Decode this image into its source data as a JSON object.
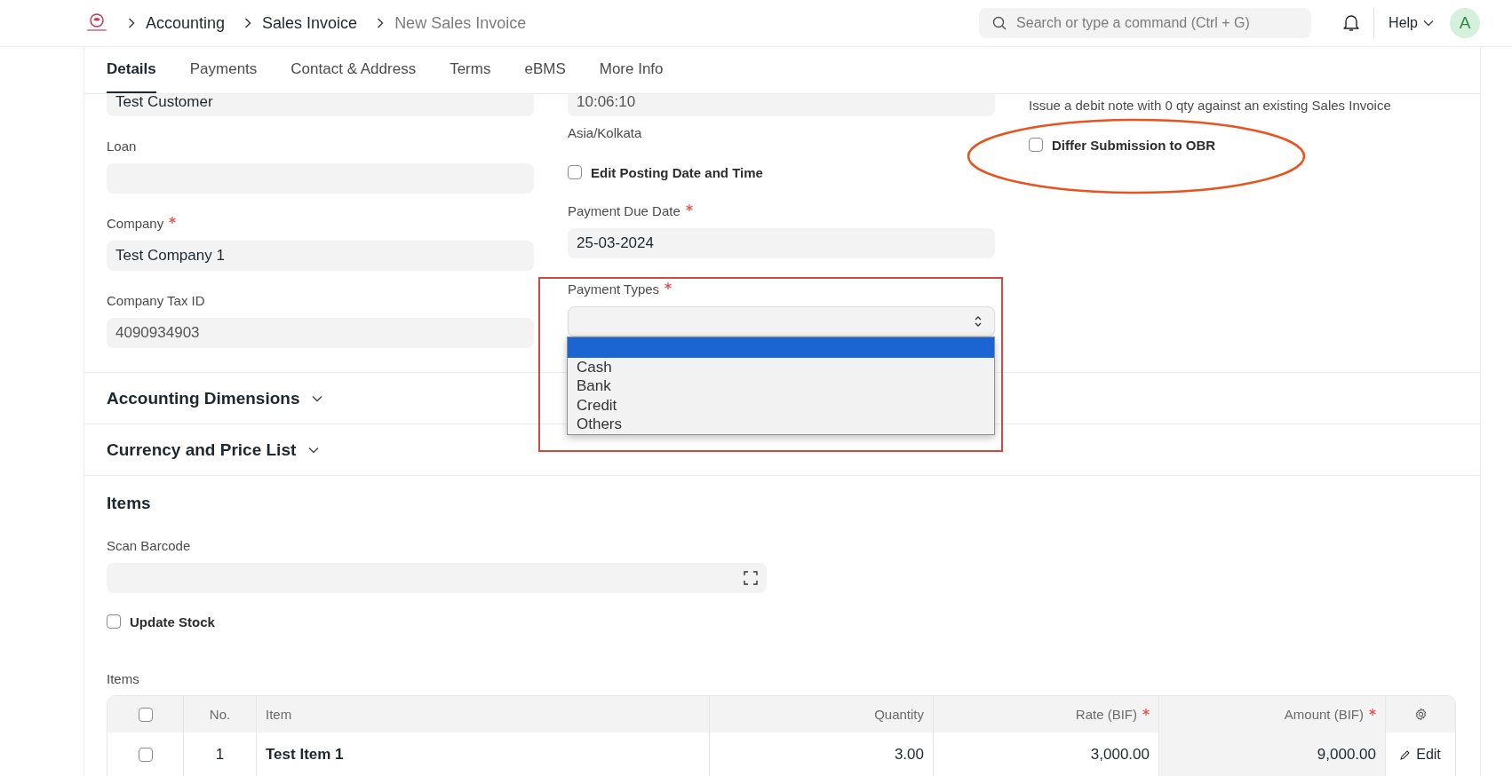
{
  "breadcrumbs": [
    {
      "label": "Accounting",
      "current": false
    },
    {
      "label": "Sales Invoice",
      "current": false
    },
    {
      "label": "New Sales Invoice",
      "current": true
    }
  ],
  "search": {
    "placeholder": "Search or type a command (Ctrl + G)"
  },
  "help": "Help",
  "avatar": "A",
  "tabs": [
    {
      "label": "Details",
      "selected": true
    },
    {
      "label": "Payments",
      "selected": false
    },
    {
      "label": "Contact & Address",
      "selected": false
    },
    {
      "label": "Terms",
      "selected": false
    },
    {
      "label": "eBMS",
      "selected": false
    },
    {
      "label": "More Info",
      "selected": false
    }
  ],
  "form_columns": [
    [
      {
        "kind": "field",
        "value": "Test Customer",
        "readonly": false
      },
      {
        "kind": "field",
        "label": "Loan",
        "required": false
      },
      {
        "kind": "field",
        "label": "Company",
        "required": true,
        "value": "Test Company 1",
        "readonly": false
      },
      {
        "kind": "field",
        "label": "Company Tax ID",
        "required": false,
        "value": "4090934903",
        "readonly": true
      }
    ],
    [
      {
        "kind": "field",
        "value": "10:06:10",
        "readonly": true
      },
      {
        "kind": "note",
        "text": "Asia/Kolkata"
      },
      {
        "kind": "checkbox",
        "label": "Edit Posting Date and Time",
        "checked": false
      },
      {
        "kind": "field",
        "label": "Payment Due Date",
        "required": true,
        "value": "25-03-2024",
        "readonly": false
      },
      {
        "kind": "select",
        "label": "Payment Types",
        "required": true,
        "open": true,
        "framed": true,
        "options": [
          {
            "selected": true
          },
          {
            "label": "Cash",
            "selected": false
          },
          {
            "label": "Bank",
            "selected": false
          },
          {
            "label": "Credit",
            "selected": false
          },
          {
            "label": "Others",
            "selected": false
          }
        ]
      }
    ],
    [
      {
        "kind": "note",
        "text": "Issue a debit note with 0 qty against an existing Sales Invoice"
      },
      {
        "kind": "checkbox",
        "label": "Differ Submission to OBR",
        "checked": false,
        "circled": true
      }
    ]
  ],
  "sections": [
    {
      "title": "Accounting Dimensions",
      "collapsed": true
    },
    {
      "title": "Currency and Price List",
      "collapsed": true
    }
  ],
  "items_section": {
    "title": "Items",
    "scan_barcode": {
      "label": "Scan Barcode"
    },
    "update_stock": {
      "label": "Update Stock",
      "checked": false
    },
    "table": {
      "label": "Items",
      "all_selected": false,
      "columns": [
        {
          "label": "No.",
          "required": false
        },
        {
          "label": "Item",
          "required": false
        },
        {
          "label": "Quantity",
          "required": false
        },
        {
          "label": "Rate (BIF)",
          "required": true
        },
        {
          "label": "Amount (BIF)",
          "required": true
        }
      ],
      "rows": [
        {
          "selected": false,
          "cells": [
            "1",
            "Test Item 1",
            "3.00",
            "3,000.00",
            "9,000.00"
          ],
          "action": "Edit"
        }
      ]
    }
  }
}
